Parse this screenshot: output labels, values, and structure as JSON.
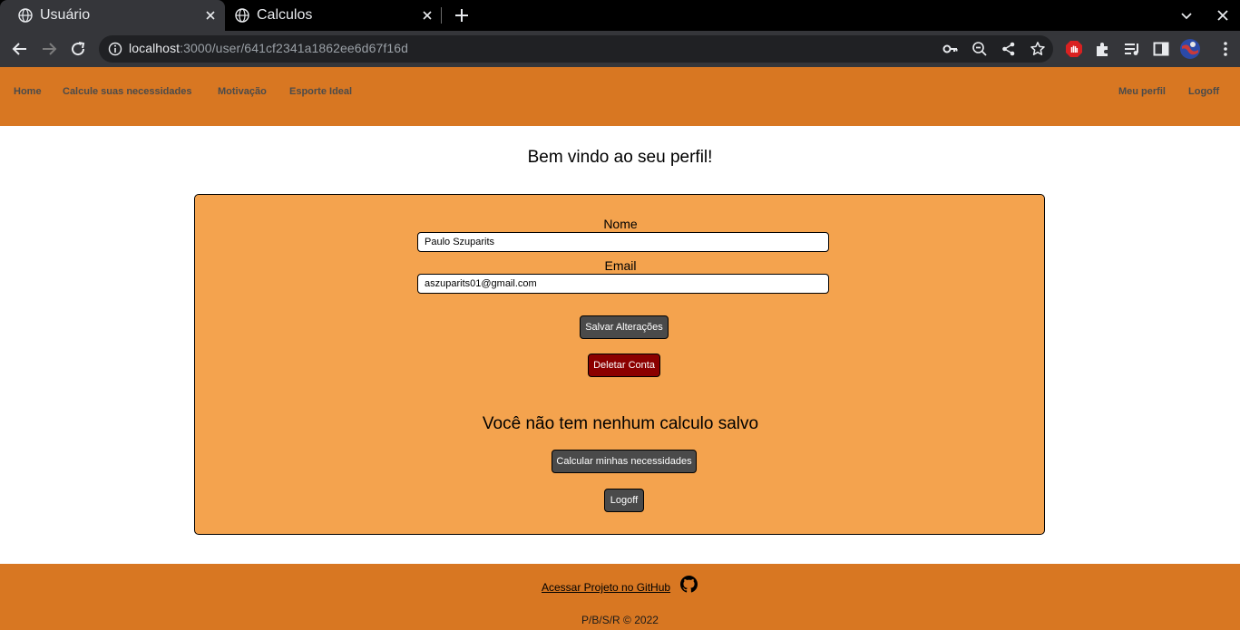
{
  "browser": {
    "tabs": [
      {
        "title": "Usuário",
        "active": true
      },
      {
        "title": "Calculos",
        "active": false
      }
    ],
    "url_host": "localhost",
    "url_path": ":3000/user/641cf2341a1862ee6d67f16d"
  },
  "nav": {
    "left": [
      "Home",
      "Calcule suas necessidades",
      "Motivação",
      "Esporte Ideal"
    ],
    "right": [
      "Meu perfil",
      "Logoff"
    ]
  },
  "page": {
    "welcome": "Bem vindo ao seu perfil!"
  },
  "form": {
    "name_label": "Nome",
    "name_value": "Paulo Szuparits",
    "email_label": "Email",
    "email_value": "aszuparits01@gmail.com",
    "save_label": "Salvar Alterações",
    "delete_label": "Deletar Conta"
  },
  "calculations": {
    "empty_message": "Você não tem nenhum calculo salvo",
    "calc_button": "Calcular minhas necessidades",
    "logoff_button": "Logoff"
  },
  "footer": {
    "github_link": "Acessar Projeto no GitHub",
    "copyright": "P/B/S/R © 2022"
  },
  "colors": {
    "nav_bg": "#d87722",
    "card_bg": "#f4a34e",
    "button_gray": "#4a4a4a",
    "button_red": "#8b0000"
  }
}
